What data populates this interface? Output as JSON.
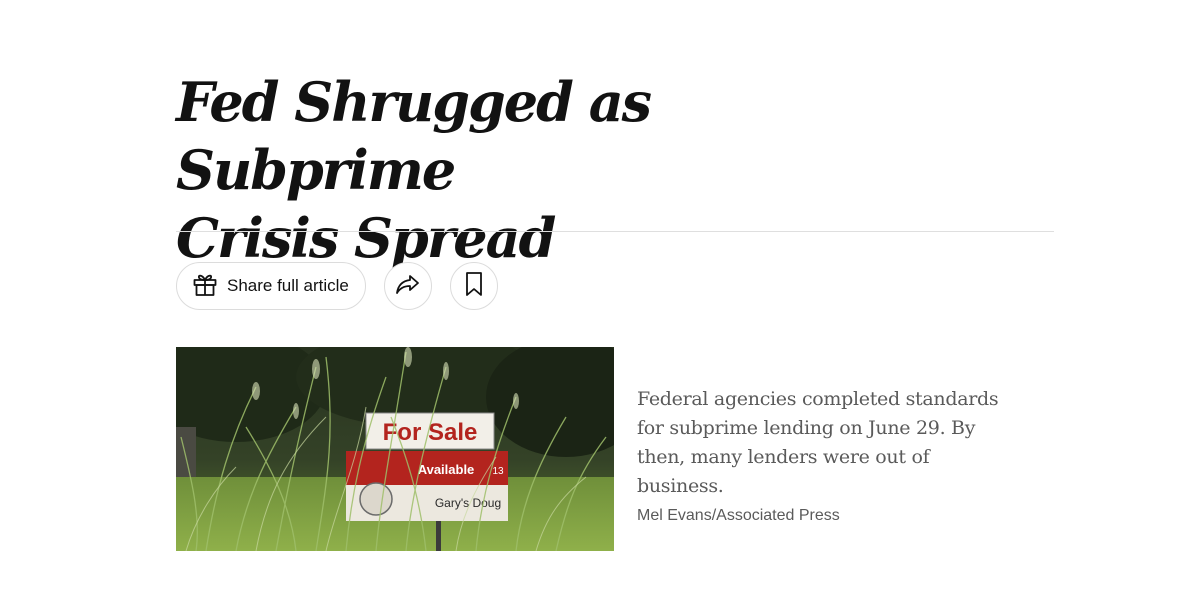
{
  "article": {
    "headline_lines": [
      "Fed Shrugged as Subprime",
      "Crisis Spread"
    ]
  },
  "toolbar": {
    "share_full_label": "Share full article",
    "share_full_icon": "gift-icon",
    "share_icon": "share-arrow-icon",
    "save_icon": "bookmark-icon"
  },
  "image": {
    "sign_title": "For Sale",
    "sign_rider": "Available",
    "sign_number": "13",
    "sign_agent": "Gary's Doug",
    "colors": {
      "sign_red": "#b3241e",
      "grass": "#6f8f3a",
      "foliage": "#2c3a22"
    }
  },
  "caption": {
    "text": "Federal agencies completed standards for subprime lending on June 29. By then, many lenders were out of business.",
    "credit": "Mel Evans/Associated Press"
  }
}
